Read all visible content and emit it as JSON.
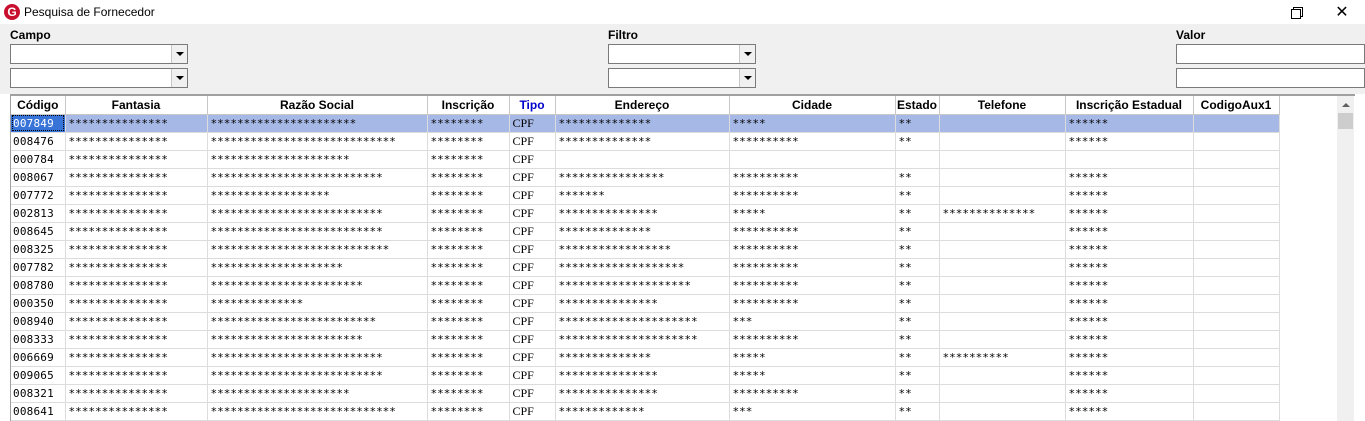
{
  "window": {
    "title": "Pesquisa de Fornecedor",
    "icon": "app-g-logo-icon",
    "accent_color": "#c8102e"
  },
  "filters": {
    "campo_label": "Campo",
    "filtro_label": "Filtro",
    "valor_label": "Valor",
    "campo_value_1": "",
    "campo_value_2": "",
    "filtro_value_1": "",
    "filtro_value_2": "",
    "valor_value_1": "",
    "valor_value_2": ""
  },
  "grid": {
    "columns": [
      "Código",
      "Fantasia",
      "Razão Social",
      "Inscrição",
      "Tipo",
      "Endereço",
      "Cidade",
      "Estado",
      "Telefone",
      "Inscrição Estadual",
      "CodigoAux1"
    ],
    "selected_row": 0,
    "selection_color": "#a6b9e6",
    "rows": [
      [
        "007849",
        "***************",
        "**********************",
        "********",
        "CPF",
        "**************",
        "*****",
        "**",
        "",
        "******",
        ""
      ],
      [
        "008476",
        "***************",
        "****************************",
        "********",
        "CPF",
        "**************",
        "**********",
        "**",
        "",
        "******",
        ""
      ],
      [
        "000784",
        "***************",
        "*********************",
        "********",
        "CPF",
        "",
        "",
        "",
        "",
        "",
        ""
      ],
      [
        "008067",
        "***************",
        "**************************",
        "********",
        "CPF",
        "****************",
        "**********",
        "**",
        "",
        "******",
        ""
      ],
      [
        "007772",
        "***************",
        "******************",
        "********",
        "CPF",
        "*******",
        "**********",
        "**",
        "",
        "******",
        ""
      ],
      [
        "002813",
        "***************",
        "**************************",
        "********",
        "CPF",
        "***************",
        "*****",
        "**",
        "**************",
        "******",
        ""
      ],
      [
        "008645",
        "***************",
        "**************************",
        "********",
        "CPF",
        "**************",
        "**********",
        "**",
        "",
        "******",
        ""
      ],
      [
        "008325",
        "***************",
        "***************************",
        "********",
        "CPF",
        "*****************",
        "**********",
        "**",
        "",
        "******",
        ""
      ],
      [
        "007782",
        "***************",
        "********************",
        "********",
        "CPF",
        "*******************",
        "**********",
        "**",
        "",
        "******",
        ""
      ],
      [
        "008780",
        "***************",
        "***********************",
        "********",
        "CPF",
        "********************",
        "**********",
        "**",
        "",
        "******",
        ""
      ],
      [
        "000350",
        "***************",
        "**************",
        "********",
        "CPF",
        "***************",
        "**********",
        "**",
        "",
        "******",
        ""
      ],
      [
        "008940",
        "***************",
        "*************************",
        "********",
        "CPF",
        "*********************",
        "***",
        "**",
        "",
        "******",
        ""
      ],
      [
        "008333",
        "***************",
        "***********************",
        "********",
        "CPF",
        "*********************",
        "**********",
        "**",
        "",
        "******",
        ""
      ],
      [
        "006669",
        "***************",
        "**************************",
        "********",
        "CPF",
        "**************",
        "*****",
        "**",
        "**********",
        "******",
        ""
      ],
      [
        "009065",
        "***************",
        "**************************",
        "********",
        "CPF",
        "***************",
        "*****",
        "**",
        "",
        "******",
        ""
      ],
      [
        "008321",
        "***************",
        "*********************",
        "********",
        "CPF",
        "***************",
        "**********",
        "**",
        "",
        "******",
        ""
      ],
      [
        "008641",
        "***************",
        "****************************",
        "********",
        "CPF",
        "*************",
        "***",
        "**",
        "",
        "******",
        ""
      ]
    ]
  },
  "scrollbar": {
    "up_icon": "scroll-up-arrow-icon"
  }
}
